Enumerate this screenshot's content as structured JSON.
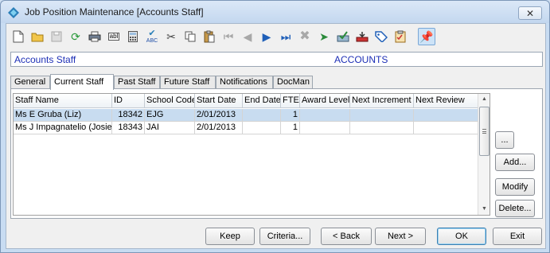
{
  "window": {
    "title": "Job Position Maintenance  [Accounts Staff]"
  },
  "toolbar": {
    "icons": [
      "new-icon",
      "open-icon",
      "save-icon",
      "refresh-icon",
      "print-icon",
      "field-icon",
      "calculator-icon",
      "spellcheck-icon",
      "cut-icon",
      "copy-icon",
      "paste-icon",
      "first-record-icon",
      "previous-record-icon",
      "next-record-icon",
      "last-record-icon",
      "delete-icon",
      "goto-icon",
      "approve-icon",
      "download-icon",
      "tag-icon",
      "checklist-icon",
      "pin-icon"
    ]
  },
  "banner": {
    "left": "Accounts Staff",
    "right": "ACCOUNTS"
  },
  "tabs": [
    {
      "label": "General"
    },
    {
      "label": "Current Staff"
    },
    {
      "label": "Past Staff"
    },
    {
      "label": "Future Staff"
    },
    {
      "label": "Notifications"
    },
    {
      "label": "DocMan"
    }
  ],
  "grid": {
    "columns": [
      "Staff Name",
      "ID",
      "School Code",
      "Start Date",
      "End Date",
      "FTE",
      "Award Level",
      "Next Increment",
      "Next Review"
    ],
    "rows": [
      [
        "Ms E Gruba (Liz)",
        "18342",
        "EJG",
        "2/01/2013",
        "",
        "1",
        "",
        "",
        ""
      ],
      [
        "Ms J Impagnatelio (Josie)",
        "18343",
        "JAI",
        "2/01/2013",
        "",
        "1",
        "",
        "",
        ""
      ]
    ]
  },
  "side_buttons": {
    "more": "...",
    "add": "Add...",
    "modify": "Modify",
    "delete": "Delete..."
  },
  "footer": {
    "keep": "Keep",
    "criteria": "Criteria...",
    "back": "< Back",
    "next": "Next >",
    "ok": "OK",
    "exit": "Exit"
  },
  "colors": {
    "banner_text": "#1d2fb6",
    "selected_row": "#c8dcf0"
  }
}
